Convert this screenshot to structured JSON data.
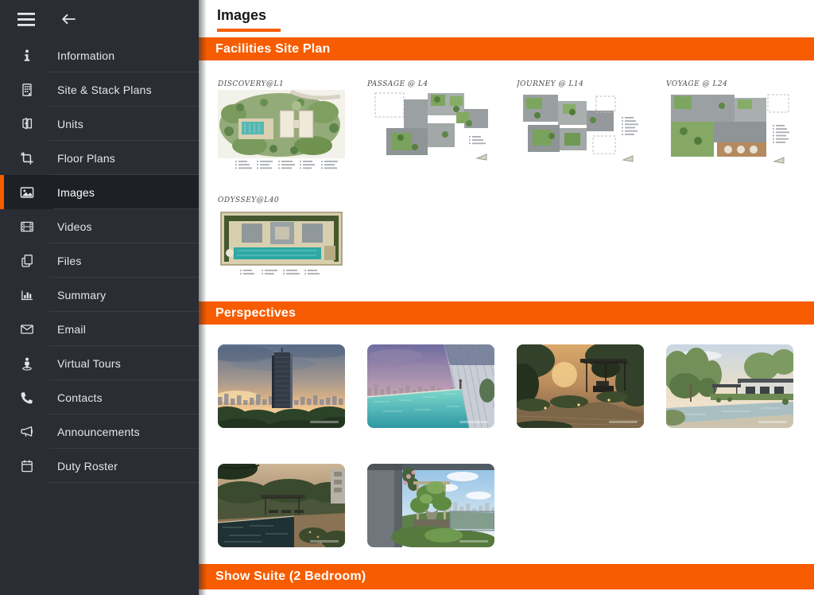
{
  "colors": {
    "accent_orange": "#F75C00",
    "sidebar_bg": "#2A2D33",
    "sidebar_active_bg": "#1D2025",
    "content_bg": "#FFFFFF"
  },
  "sidebar": {
    "top": {
      "menu_icon": "hamburger-icon",
      "back_icon": "arrow-left-icon"
    },
    "items": [
      {
        "label": "Information",
        "icon": "info-icon",
        "active": false
      },
      {
        "label": "Site & Stack Plans",
        "icon": "building-icon",
        "active": false
      },
      {
        "label": "Units",
        "icon": "door-open-icon",
        "active": false
      },
      {
        "label": "Floor Plans",
        "icon": "crop-icon",
        "active": false
      },
      {
        "label": "Images",
        "icon": "image-icon",
        "active": true
      },
      {
        "label": "Videos",
        "icon": "film-icon",
        "active": false
      },
      {
        "label": "Files",
        "icon": "copy-icon",
        "active": false
      },
      {
        "label": "Summary",
        "icon": "bar-chart-icon",
        "active": false
      },
      {
        "label": "Email",
        "icon": "envelope-icon",
        "active": false
      },
      {
        "label": "Virtual Tours",
        "icon": "street-view-icon",
        "active": false
      },
      {
        "label": "Contacts",
        "icon": "phone-icon",
        "active": false
      },
      {
        "label": "Announcements",
        "icon": "megaphone-icon",
        "active": false
      },
      {
        "label": "Duty Roster",
        "icon": "calendar-icon",
        "active": false
      }
    ]
  },
  "page": {
    "title": "Images"
  },
  "sections": [
    {
      "title": "Facilities Site Plan",
      "images": [
        {
          "caption": "DISCOVERY@L1",
          "art": "discovery"
        },
        {
          "caption": "PASSAGE @ L4",
          "art": "passage"
        },
        {
          "caption": "JOURNEY @ L14",
          "art": "journey"
        },
        {
          "caption": "VOYAGE @ L24",
          "art": "voyage"
        },
        {
          "caption": "ODYSSEY@L40",
          "art": "odyssey"
        }
      ]
    },
    {
      "title": "Perspectives",
      "images": [
        {
          "caption": "",
          "art": "tower-sunset"
        },
        {
          "caption": "",
          "art": "pool-facade"
        },
        {
          "caption": "",
          "art": "terrace-dusk"
        },
        {
          "caption": "",
          "art": "villa-pool-dawn"
        },
        {
          "caption": "",
          "art": "pool-deck-dusk"
        },
        {
          "caption": "",
          "art": "balcony-garden"
        }
      ]
    },
    {
      "title": "Show Suite (2 Bedroom)",
      "images": []
    }
  ]
}
